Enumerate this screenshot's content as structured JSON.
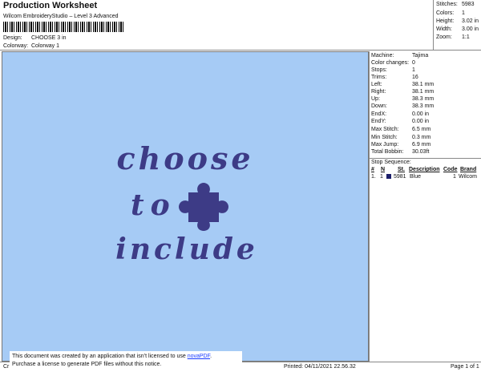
{
  "header": {
    "title": "Production Worksheet",
    "subtitle": "Wilcom EmbroideryStudio – Level 3 Advanced",
    "design_label": "Design:",
    "design_value": "CHOOSE 3 in",
    "colorway_label": "Colorway:",
    "colorway_value": "Colorway 1"
  },
  "stats": [
    {
      "label": "Stitches:",
      "value": "5983"
    },
    {
      "label": "Colors:",
      "value": "1"
    },
    {
      "label": "Height:",
      "value": "3.02 in"
    },
    {
      "label": "Width:",
      "value": "3.00 in"
    },
    {
      "label": "Zoom:",
      "value": "1:1"
    }
  ],
  "machine_info": [
    {
      "label": "Machine:",
      "value": "Tajima"
    },
    {
      "label": "Color changes:",
      "value": "0"
    },
    {
      "label": "Stops:",
      "value": "1"
    },
    {
      "label": "Trims:",
      "value": "16"
    },
    {
      "label": "Left:",
      "value": "38.1 mm"
    },
    {
      "label": "Right:",
      "value": "38.1 mm"
    },
    {
      "label": "Up:",
      "value": "38.3 mm"
    },
    {
      "label": "Down:",
      "value": "38.3 mm"
    },
    {
      "label": "EndX:",
      "value": "0.00 in"
    },
    {
      "label": "EndY:",
      "value": "0.00 in"
    },
    {
      "label": "Max Stitch:",
      "value": "6.5 mm"
    },
    {
      "label": "Min Stitch:",
      "value": "0.3 mm"
    },
    {
      "label": "Max Jump:",
      "value": "6.9 mm"
    },
    {
      "label": "Total Bobbin:",
      "value": "30.03ft"
    }
  ],
  "stop_sequence": {
    "title": "Stop Sequence:",
    "headers": [
      "#",
      "N",
      "St.",
      "Description",
      "Code",
      "Brand"
    ],
    "rows": [
      {
        "num": "1.",
        "n": "1",
        "stitches": "5981",
        "description": "Blue",
        "code": "1",
        "brand": "Wilcom",
        "color": "#1c1f6b"
      }
    ]
  },
  "design": {
    "line1": "choose",
    "line2": "to",
    "line3": "include",
    "thread_color": "#3d3b86",
    "background_color": "#a6cbf5"
  },
  "footer": {
    "left": "Cr",
    "printed": "Printed: 04/11/2021 22.56.32",
    "page": "Page 1 of 1"
  },
  "notice": {
    "line1_pre": "This document was created by an application that isn’t licensed to use ",
    "line1_link": "novaPDF",
    "line1_post": ".",
    "line2": "Purchase a license to generate PDF files without this notice."
  }
}
